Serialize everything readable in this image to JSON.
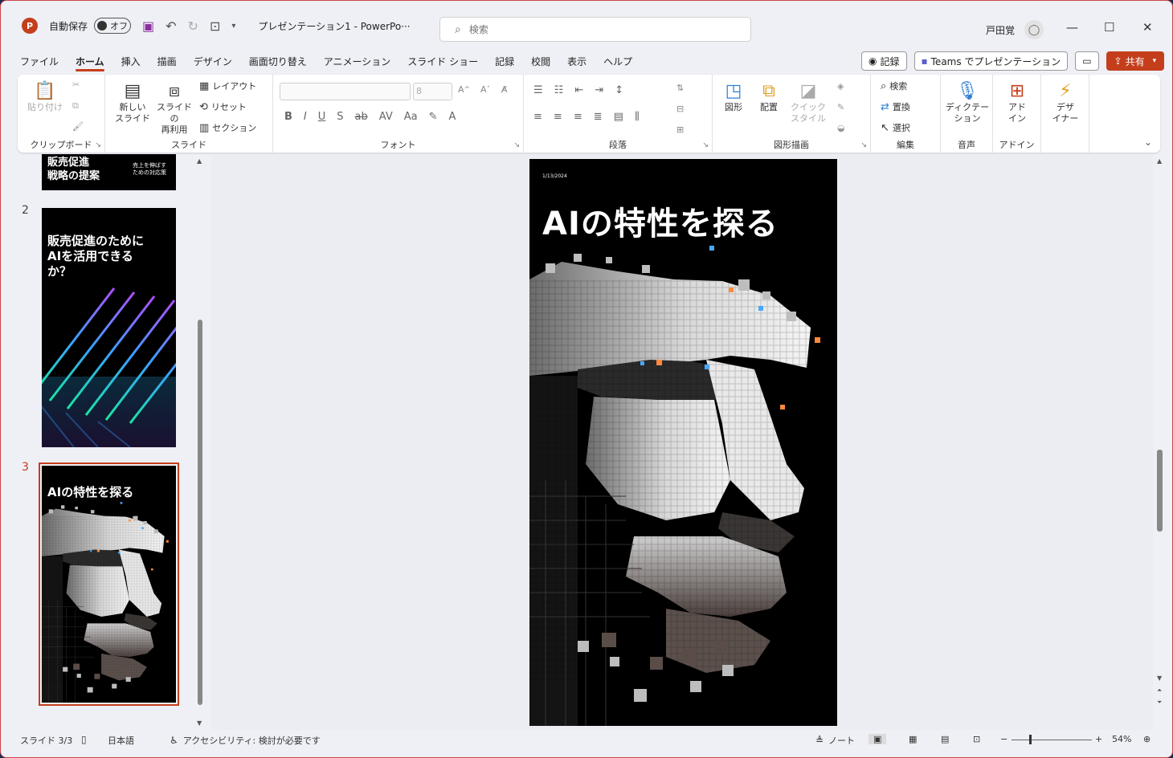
{
  "titlebar": {
    "app_icon": "P",
    "autosave_label": "自動保存",
    "autosave_state": "オフ",
    "doc_title": "プレゼンテーション1  -  PowerPo···",
    "search_placeholder": "検索",
    "user_name": "戸田覚"
  },
  "menu": {
    "tabs": [
      "ファイル",
      "ホーム",
      "挿入",
      "描画",
      "デザイン",
      "画面切り替え",
      "アニメーション",
      "スライド ショー",
      "記録",
      "校閲",
      "表示",
      "ヘルプ"
    ],
    "active": "ホーム",
    "record_btn": "記録",
    "teams_btn": "Teams でプレゼンテーション",
    "share_btn": "共有"
  },
  "ribbon": {
    "clipboard": {
      "label": "クリップボード",
      "paste": "貼り付け"
    },
    "slides": {
      "label": "スライド",
      "new_slide_1": "新しい",
      "new_slide_2": "スライド",
      "reuse_1": "スライドの",
      "reuse_2": "再利用",
      "layout": "レイアウト",
      "reset": "リセット",
      "section": "セクション"
    },
    "font": {
      "label": "フォント",
      "size": "8"
    },
    "paragraph": {
      "label": "段落"
    },
    "drawing": {
      "label": "図形描画",
      "shapes": "図形",
      "arrange": "配置",
      "quick_1": "クイック",
      "quick_2": "スタイル"
    },
    "editing": {
      "label": "編集",
      "find": "検索",
      "replace": "置換",
      "select": "選択"
    },
    "voice": {
      "label": "音声",
      "dictate_1": "ディクテー",
      "dictate_2": "ション"
    },
    "addins": {
      "label": "アドイン",
      "addin_1": "アド",
      "addin_2": "イン"
    },
    "designer": {
      "label_1": "デザ",
      "label_2": "イナー"
    }
  },
  "thumbnails": {
    "slide1_title_1": "販売促進",
    "slide1_title_2": "戦略の提案",
    "slide1_sub_1": "売上を伸ばす",
    "slide1_sub_2": "ための対応策",
    "slide2_num": "2",
    "slide2_title_1": "販売促進のために",
    "slide2_title_2": "AIを活用できる",
    "slide2_title_3": "か？",
    "slide3_num": "3",
    "slide3_title": "AIの特性を探る"
  },
  "slide": {
    "date": "1/13/2024",
    "title": "AIの特性を探る"
  },
  "status": {
    "slide_counter": "スライド 3/3",
    "language": "日本語",
    "accessibility": "アクセシビリティ: 検討が必要です",
    "notes": "ノート",
    "zoom": "54%"
  },
  "colors": {
    "accent": "#c43e1c",
    "ribbon_bg": "#ffffff",
    "window_bg": "#eef0f5"
  }
}
